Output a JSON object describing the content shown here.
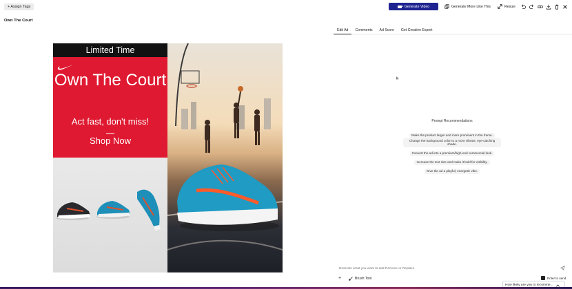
{
  "header": {
    "assign_tags": "+ Assign Tags",
    "generate_video": "Generate Video",
    "generate_more": "Generate More Like This",
    "resize": "Resize",
    "icons": [
      "undo-icon",
      "redo-icon",
      "link-icon",
      "download-icon",
      "trash-icon",
      "close-icon"
    ]
  },
  "page": {
    "title": "Own The Court"
  },
  "ad": {
    "banner": "Limited Time",
    "headline": "Own The Court",
    "subline": "Act fast, don't miss!",
    "cta": "Shop Now",
    "brand_color": "#df1931"
  },
  "panel": {
    "tabs": [
      "Edit Ad",
      "Comments",
      "Ad Score",
      "Get Creative Expert"
    ],
    "active_tab": "Edit Ad",
    "prompt_header": "Prompt Recommendations",
    "recommendations": [
      "Make the product larger and more prominent in the frame.",
      "Change the background color to a more vibrant, eye-catching shade.",
      "Convert the ad into a premium/high-end commercial look.",
      "Increase the text size and make it bold for visibility.",
      "Give the ad a playful, energetic vibe."
    ],
    "composer_placeholder": "Describe what you want to add Remove or Replace",
    "brush_tool": "Brush Tool",
    "enter_to_send": "Enter to send"
  },
  "survey": {
    "label": "How likely are you to recomme..."
  },
  "colors": {
    "accent": "#1f2390"
  }
}
